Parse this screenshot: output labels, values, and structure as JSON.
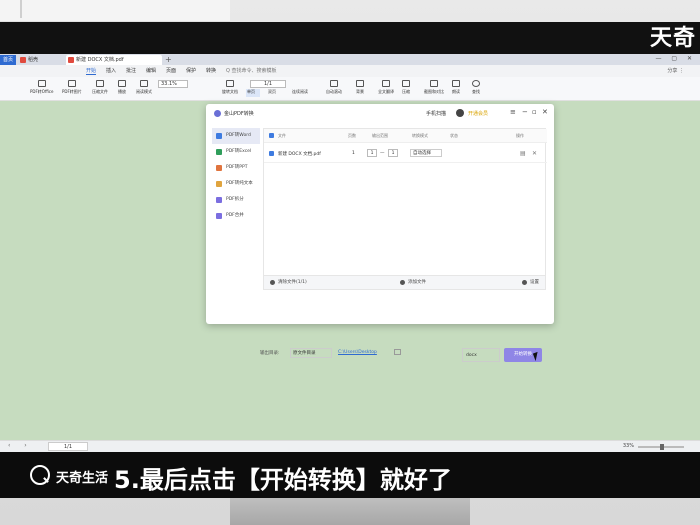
{
  "overlay": {
    "watermark": "天奇",
    "brand": "天奇生活",
    "subtitle": "5.最后点击【开始转换】就好了"
  },
  "browser": {
    "tabs": [
      {
        "label": "首页"
      },
      {
        "label": "稻壳"
      },
      {
        "label": "新建 DOCX 文档.pdf"
      }
    ],
    "new_tab": "+"
  },
  "menu": {
    "items": [
      "开始",
      "插入",
      "批注",
      "编辑",
      "页面",
      "保护",
      "转换"
    ],
    "search": "Q 查找命令、搜索模板",
    "right": "分享 ⋮"
  },
  "toolbar": {
    "tools": [
      "PDF转Office",
      "PDF转图片",
      "压缩文件",
      "播放",
      "阅读模式",
      "旋转文档",
      "单页",
      "双页",
      "连续阅读",
      "自动滚动",
      "背景",
      "全文翻译",
      "压缩",
      "截图和对比",
      "朗读",
      "查找"
    ],
    "zoom": "33.1%",
    "page": "1/1"
  },
  "dialog": {
    "title": "金山PDF转换",
    "bind_phone": "手机扫描",
    "member": "开通会员",
    "sidebar": [
      {
        "label": "PDF转Word",
        "color": "#3e7be0"
      },
      {
        "label": "PDF转Excel",
        "color": "#2f9e5b"
      },
      {
        "label": "PDF转PPT",
        "color": "#e0743e"
      },
      {
        "label": "PDF转纯文本",
        "color": "#e0a43e"
      },
      {
        "label": "PDF拆分",
        "color": "#7b6ee0"
      },
      {
        "label": "PDF合并",
        "color": "#7b6ee0"
      }
    ],
    "table": {
      "headers": [
        "文件",
        "页数",
        "输出范围",
        "转换模式",
        "状态",
        "操作"
      ],
      "row": {
        "name": "新建 DOCX 文档.pdf",
        "pages": "1",
        "from": "1",
        "sep": "—",
        "to": "1",
        "mode": "自动选择"
      }
    },
    "footer": {
      "clear": "清除文件(1/1)",
      "add": "添加文件",
      "settings": "设置"
    },
    "output": {
      "label": "输出目录:",
      "select": "原文件目录",
      "path": "C:\\Users\\Desktop",
      "format": "docx",
      "start": "开始转换"
    }
  },
  "statusbar": {
    "page": "1/1",
    "zoom": "33%"
  }
}
